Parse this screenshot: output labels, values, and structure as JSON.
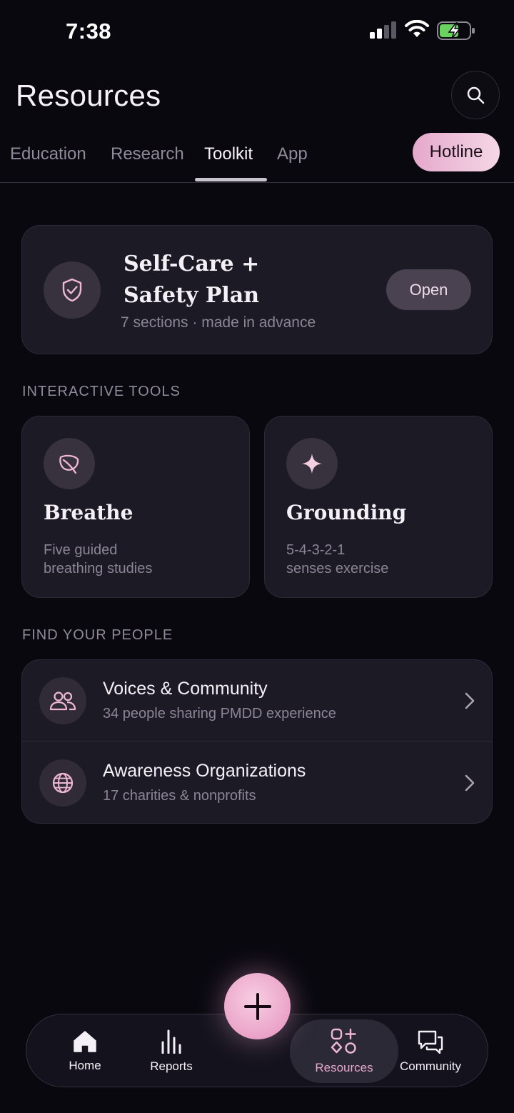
{
  "status_bar": {
    "time": "7:38"
  },
  "header": {
    "title": "Resources"
  },
  "tabs": [
    {
      "label": "Education"
    },
    {
      "label": "Research"
    },
    {
      "label": "Toolkit"
    },
    {
      "label": "App"
    }
  ],
  "active_tab": "Toolkit",
  "hotline": {
    "label": "Hotline"
  },
  "safety_plan": {
    "title": "Self-Care + Safety Plan",
    "subtitle": "7 sections · made in advance",
    "action": "Open"
  },
  "interactive_tools": {
    "heading": "INTERACTIVE TOOLS",
    "items": [
      {
        "title": "Breathe",
        "desc_line1": "Five guided",
        "desc_line2": "breathing studies",
        "icon": "leaf-icon"
      },
      {
        "title": "Grounding",
        "desc_line1": "5-4-3-2-1",
        "desc_line2": "senses exercise",
        "icon": "sparkle-icon"
      }
    ]
  },
  "find_people": {
    "heading": "FIND YOUR PEOPLE",
    "items": [
      {
        "title": "Voices & Community",
        "subtitle": "34 people sharing PMDD experience",
        "icon": "people-icon"
      },
      {
        "title": "Awareness Organizations",
        "subtitle": "17 charities & nonprofits",
        "icon": "globe-icon"
      }
    ]
  },
  "bottom_nav": {
    "items": [
      {
        "label": "Home",
        "icon": "home-icon"
      },
      {
        "label": "Reports",
        "icon": "bar-chart-icon"
      },
      {
        "label": "Resources",
        "icon": "shapes-icon"
      },
      {
        "label": "Community",
        "icon": "chat-icon"
      }
    ],
    "active": "Resources"
  },
  "colors": {
    "background": "#09080f",
    "card": "#1c1a25",
    "accent_pink": "#e6a8cb",
    "muted_text": "#8b8695",
    "battery_green": "#6ad25e"
  }
}
